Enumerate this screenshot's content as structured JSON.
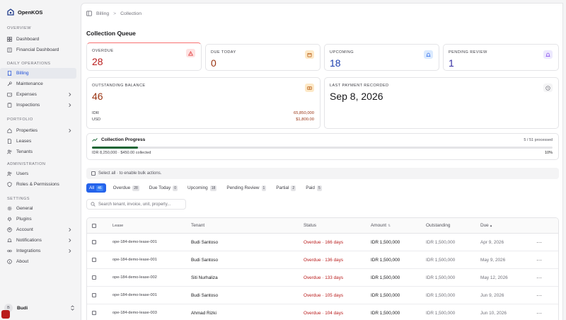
{
  "app": {
    "name": "OpenKOS"
  },
  "sidebar": {
    "groups": [
      {
        "title": "OVERVIEW",
        "items": [
          {
            "label": "Dashboard"
          },
          {
            "label": "Financial Dashboard"
          }
        ]
      },
      {
        "title": "DAILY OPERATIONS",
        "items": [
          {
            "label": "Billing"
          },
          {
            "label": "Maintenance"
          },
          {
            "label": "Expenses"
          },
          {
            "label": "Inspections"
          }
        ]
      },
      {
        "title": "PORTFOLIO",
        "items": [
          {
            "label": "Properties"
          },
          {
            "label": "Leases"
          },
          {
            "label": "Tenants"
          }
        ]
      },
      {
        "title": "ADMINISTRATION",
        "items": [
          {
            "label": "Users"
          },
          {
            "label": "Roles & Permissions"
          }
        ]
      },
      {
        "title": "SETTINGS",
        "items": [
          {
            "label": "General"
          },
          {
            "label": "Plugins"
          },
          {
            "label": "Account"
          },
          {
            "label": "Notifications"
          },
          {
            "label": "Integrations"
          },
          {
            "label": "About"
          }
        ]
      }
    ],
    "active": "Billing",
    "user": {
      "initial": "B",
      "name": "Budi"
    }
  },
  "breadcrumb": {
    "parent": "Billing",
    "separator": ">",
    "current": "Collection"
  },
  "page": {
    "title": "Collection Queue"
  },
  "stats": {
    "overdue": {
      "label": "OVERDUE",
      "value": "28"
    },
    "due_today": {
      "label": "DUE TODAY",
      "value": "0"
    },
    "upcoming": {
      "label": "UPCOMING",
      "value": "18"
    },
    "pending_review": {
      "label": "PENDING REVIEW",
      "value": "1"
    }
  },
  "balance": {
    "label": "OUTSTANDING BALANCE",
    "value": "46",
    "rows": [
      {
        "currency": "IDR",
        "amount": "65,850,000"
      },
      {
        "currency": "USD",
        "amount": "$1,800.00"
      }
    ]
  },
  "last_payment": {
    "label": "LAST PAYMENT RECORDED",
    "value": "Sep 8, 2026"
  },
  "progress": {
    "title": "Collection Progress",
    "count": "5 / 51 processed",
    "collected": "IDR 8,250,000 · $450.00 collected",
    "percent_label": "10%",
    "fraction": 0.1
  },
  "bulk": {
    "text": "Select all  · to enable bulk actions."
  },
  "tabs": [
    {
      "label": "All",
      "count": "46"
    },
    {
      "label": "Overdue",
      "count": "28"
    },
    {
      "label": "Due Today",
      "count": "0"
    },
    {
      "label": "Upcoming",
      "count": "18"
    },
    {
      "label": "Pending Review",
      "count": "1"
    },
    {
      "label": "Partial",
      "count": "2"
    },
    {
      "label": "Paid",
      "count": "5"
    }
  ],
  "search": {
    "placeholder": "Search tenant, invoice, unit, property..."
  },
  "table": {
    "columns": {
      "lease": "Lease",
      "tenant": "Tenant",
      "status": "Status",
      "amount": "Amount",
      "outstanding": "Outstanding",
      "due": "Due"
    },
    "rows": [
      {
        "lease": "ope-184-demo-lease-001",
        "tenant": "Budi Santoso",
        "status": "Overdue · 166 days",
        "amount": "IDR 1,500,000",
        "outstanding": "IDR 1,500,000",
        "due": "Apr 9, 2026"
      },
      {
        "lease": "ope-184-demo-lease-001",
        "tenant": "Budi Santoso",
        "status": "Overdue · 136 days",
        "amount": "IDR 1,500,000",
        "outstanding": "IDR 1,500,000",
        "due": "May 9, 2026"
      },
      {
        "lease": "ope-184-demo-lease-002",
        "tenant": "Siti Nurhaliza",
        "status": "Overdue · 133 days",
        "amount": "IDR 1,500,000",
        "outstanding": "IDR 1,500,000",
        "due": "May 12, 2026"
      },
      {
        "lease": "ope-184-demo-lease-001",
        "tenant": "Budi Santoso",
        "status": "Overdue · 105 days",
        "amount": "IDR 1,500,000",
        "outstanding": "IDR 1,500,000",
        "due": "Jun 9, 2026"
      },
      {
        "lease": "ope-184-demo-lease-003",
        "tenant": "Ahmad Rizki",
        "status": "Overdue · 104 days",
        "amount": "IDR 1,500,000",
        "outstanding": "IDR 1,500,000",
        "due": "Jun 10, 2026"
      }
    ],
    "more_glyph": "···"
  }
}
